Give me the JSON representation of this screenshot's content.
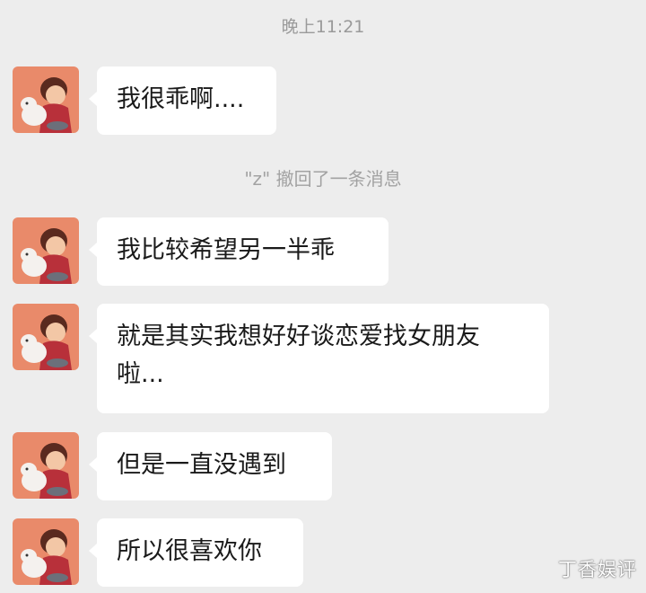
{
  "chat": {
    "timestamp": "晚上11:21",
    "recall_notice": "\"z\" 撤回了一条消息",
    "messages": [
      {
        "sender": "other",
        "text": "我很乖啊...."
      },
      {
        "sender": "other",
        "text": "我比较希望另一半乖"
      },
      {
        "sender": "other",
        "text": "就是其实我想好好谈恋爱找女朋友\n啦..."
      },
      {
        "sender": "other",
        "text": "但是一直没遇到"
      },
      {
        "sender": "other",
        "text": "所以很喜欢你"
      }
    ]
  },
  "avatar_icon": "cartoon-boy-with-dog-avatar",
  "watermark": "丁香娱评",
  "colors": {
    "background": "#ededed",
    "bubble": "#ffffff",
    "avatar_bg": "#e98a6a"
  }
}
